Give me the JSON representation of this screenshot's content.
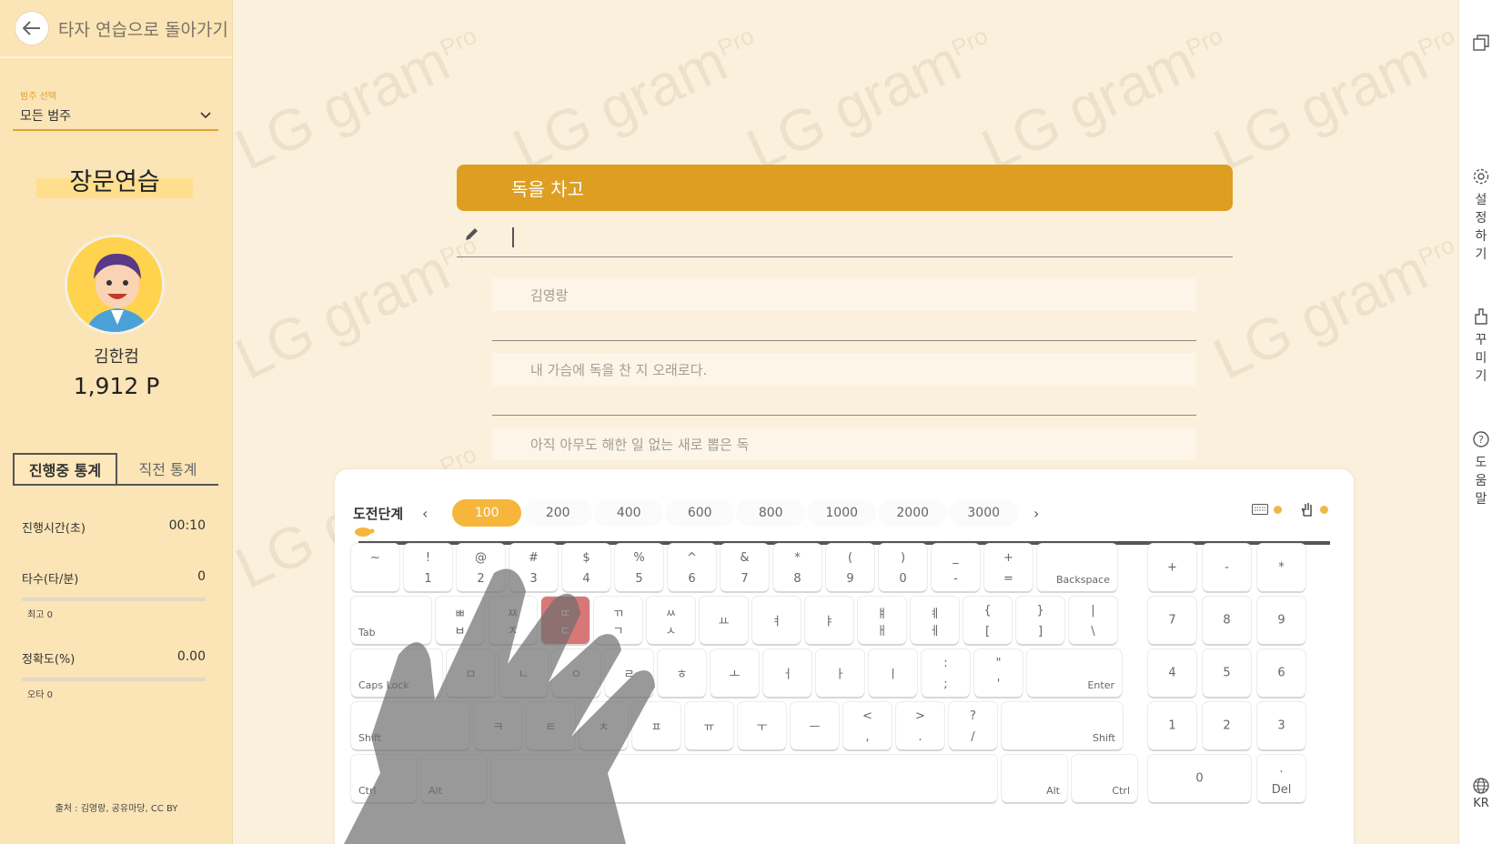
{
  "header": {
    "back_label": "타자 연습으로 돌아가기"
  },
  "category": {
    "label": "범주 선택",
    "value": "모든 범주"
  },
  "mode_title": "장문연습",
  "user": {
    "name": "김한컴",
    "points": "1,912 P"
  },
  "stats_tabs": [
    "진행중 통계",
    "직전 통계"
  ],
  "stats": {
    "time": {
      "label": "진행시간(초)",
      "value": "00:10"
    },
    "speed": {
      "label": "타수(타/분)",
      "value": "0",
      "sub": "최고 0",
      "fill": 0
    },
    "accuracy": {
      "label": "정확도(%)",
      "value": "0.00",
      "sub": "오타 0",
      "fill": 0
    }
  },
  "source": "출처 : 김영랑, 공유마당, CC BY",
  "watermark": "LG gram",
  "watermark_sup": "Pro",
  "practice": {
    "current_line": "독을 차고",
    "upcoming": [
      "김영랑",
      "내 가슴에 독을 찬 지 오래로다.",
      "아직 아무도 해한 일 없는 새로 뽑은 독"
    ]
  },
  "levels": {
    "title": "도전단계",
    "items": [
      "100",
      "200",
      "400",
      "600",
      "800",
      "1000",
      "2000",
      "3000"
    ],
    "active": "100"
  },
  "right_sidebar": {
    "settings": "설정하기",
    "decorate": "꾸미기",
    "help": "도움말",
    "lang": "KR"
  },
  "keys": {
    "row1": [
      [
        "~",
        ""
      ],
      [
        "!",
        "1"
      ],
      [
        "@",
        "2"
      ],
      [
        "#",
        "3"
      ],
      [
        "$",
        "4"
      ],
      [
        "%",
        "5"
      ],
      [
        "^",
        "6"
      ],
      [
        "&",
        "7"
      ],
      [
        "*",
        "8"
      ],
      [
        "(",
        "9"
      ],
      [
        ")",
        "0"
      ],
      [
        "_",
        "-"
      ],
      [
        "+",
        "="
      ]
    ],
    "backspace": "Backspace",
    "row2": [
      [
        "ㅃ",
        "ㅂ"
      ],
      [
        "ㅉ",
        "ㅈ"
      ],
      [
        "ㄸ",
        "ㄷ"
      ],
      [
        "ㄲ",
        "ㄱ"
      ],
      [
        "ㅆ",
        "ㅅ"
      ],
      [
        "",
        "ㅛ"
      ],
      [
        "",
        "ㅕ"
      ],
      [
        "",
        "ㅑ"
      ],
      [
        "ㅒ",
        "ㅐ"
      ],
      [
        "ㅖ",
        "ㅔ"
      ],
      [
        "{",
        "["
      ],
      [
        "}",
        "]"
      ],
      [
        "|",
        "\\"
      ]
    ],
    "tab": "Tab",
    "row3": [
      "ㅁ",
      "ㄴ",
      "ㅇ",
      "ㄹ",
      "ㅎ",
      "ㅗ",
      "ㅓ",
      "ㅏ",
      "ㅣ"
    ],
    "row3_extra": [
      [
        ":",
        ";"
      ],
      [
        "\"",
        "'"
      ]
    ],
    "capslock": "Caps Lock",
    "enter": "Enter",
    "row4": [
      "ㅋ",
      "ㅌ",
      "ㅊ",
      "ㅍ",
      "ㅠ",
      "ㅜ",
      "ㅡ"
    ],
    "row4_extra": [
      [
        "<",
        ","
      ],
      [
        ">",
        "."
      ],
      [
        "?",
        "/"
      ]
    ],
    "shift": "Shift",
    "ctrl": "Ctrl",
    "alt": "Alt",
    "numpad": [
      "+",
      "-",
      "*",
      "7",
      "8",
      "9",
      "4",
      "5",
      "6",
      "1",
      "2",
      "3",
      "0"
    ],
    "numpad_del_top": ".",
    "numpad_del": "Del",
    "highlighted": "ㄷ"
  }
}
